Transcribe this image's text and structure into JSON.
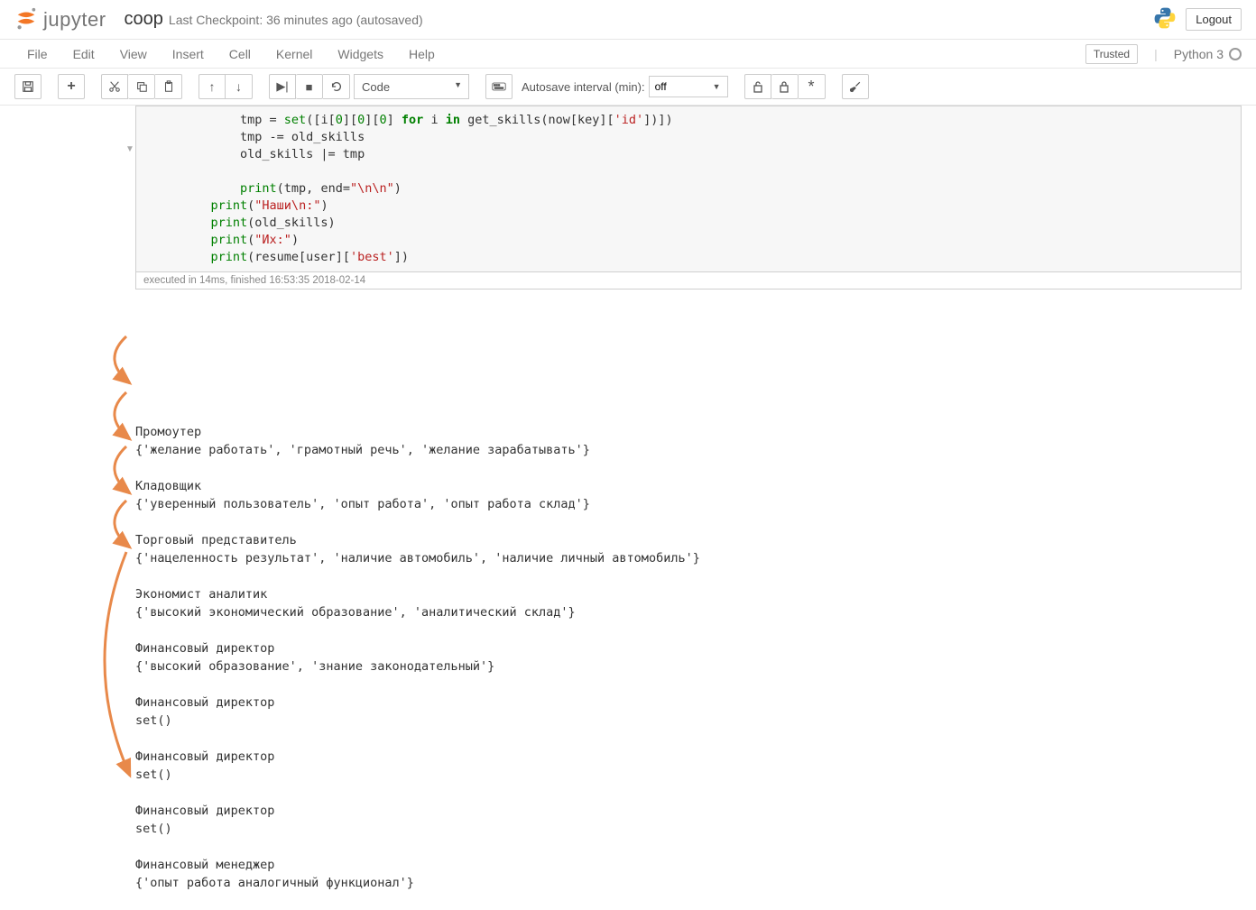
{
  "header": {
    "logo_text": "jupyter",
    "notebook_name": "coop",
    "checkpoint": "Last Checkpoint: 36 minutes ago (autosaved)",
    "logout": "Logout"
  },
  "menubar": {
    "items": [
      "File",
      "Edit",
      "View",
      "Insert",
      "Cell",
      "Kernel",
      "Widgets",
      "Help"
    ],
    "trusted": "Trusted",
    "kernel": "Python 3"
  },
  "toolbar": {
    "celltype_selected": "Code",
    "autosave_label": "Autosave interval (min):",
    "autosave_selected": "off"
  },
  "code_cell": {
    "exec_info": "executed in 14ms, finished 16:53:35 2018-02-14",
    "lines": [
      {
        "indent": "        ",
        "parts": [
          {
            "t": "tmp = "
          },
          {
            "t": "set",
            "c": "builtin-green"
          },
          {
            "t": "([i["
          },
          {
            "t": "0",
            "c": "num-green"
          },
          {
            "t": "]["
          },
          {
            "t": "0",
            "c": "num-green"
          },
          {
            "t": "]["
          },
          {
            "t": "0",
            "c": "num-green"
          },
          {
            "t": "] "
          },
          {
            "t": "for",
            "c": "kw-green"
          },
          {
            "t": " i "
          },
          {
            "t": "in",
            "c": "kw-green"
          },
          {
            "t": " get_skills(now[key]["
          },
          {
            "t": "'id'",
            "c": "str-red"
          },
          {
            "t": "])])"
          }
        ]
      },
      {
        "indent": "        ",
        "parts": [
          {
            "t": "tmp -= old_skills"
          }
        ]
      },
      {
        "indent": "        ",
        "parts": [
          {
            "t": "old_skills |= tmp"
          }
        ]
      },
      {
        "indent": "",
        "parts": [
          {
            "t": ""
          }
        ]
      },
      {
        "indent": "        ",
        "parts": [
          {
            "t": "print",
            "c": "builtin-green"
          },
          {
            "t": "(tmp, end="
          },
          {
            "t": "\"\\n\\n\"",
            "c": "str-red"
          },
          {
            "t": ")"
          }
        ]
      },
      {
        "indent": "    ",
        "parts": [
          {
            "t": "print",
            "c": "builtin-green"
          },
          {
            "t": "("
          },
          {
            "t": "\"Наши\\n:\"",
            "c": "str-red"
          },
          {
            "t": ")"
          }
        ]
      },
      {
        "indent": "    ",
        "parts": [
          {
            "t": "print",
            "c": "builtin-green"
          },
          {
            "t": "(old_skills)"
          }
        ]
      },
      {
        "indent": "    ",
        "parts": [
          {
            "t": "print",
            "c": "builtin-green"
          },
          {
            "t": "("
          },
          {
            "t": "\"Их:\"",
            "c": "str-red"
          },
          {
            "t": ")"
          }
        ]
      },
      {
        "indent": "    ",
        "parts": [
          {
            "t": "print",
            "c": "builtin-green"
          },
          {
            "t": "(resume[user]["
          },
          {
            "t": "'best'",
            "c": "str-red"
          },
          {
            "t": "])"
          }
        ]
      }
    ]
  },
  "output_lines": [
    "Промоутер",
    "{'желание работать', 'грамотный речь', 'желание зарабатывать'}",
    "",
    "Кладовщик",
    "{'уверенный пользователь', 'опыт работа', 'опыт работа склад'}",
    "",
    "Торговый представитель",
    "{'нацеленность результат', 'наличие автомобиль', 'наличие личный автомобиль'}",
    "",
    "Экономист аналитик",
    "{'высокий экономический образование', 'аналитический склад'}",
    "",
    "Финансовый директор",
    "{'высокий образование', 'знание законодательный'}",
    "",
    "Финансовый директор",
    "set()",
    "",
    "Финансовый директор",
    "set()",
    "",
    "Финансовый директор",
    "set()",
    "",
    "Финансовый менеджер",
    "{'опыт работа аналогичный функционал'}"
  ]
}
